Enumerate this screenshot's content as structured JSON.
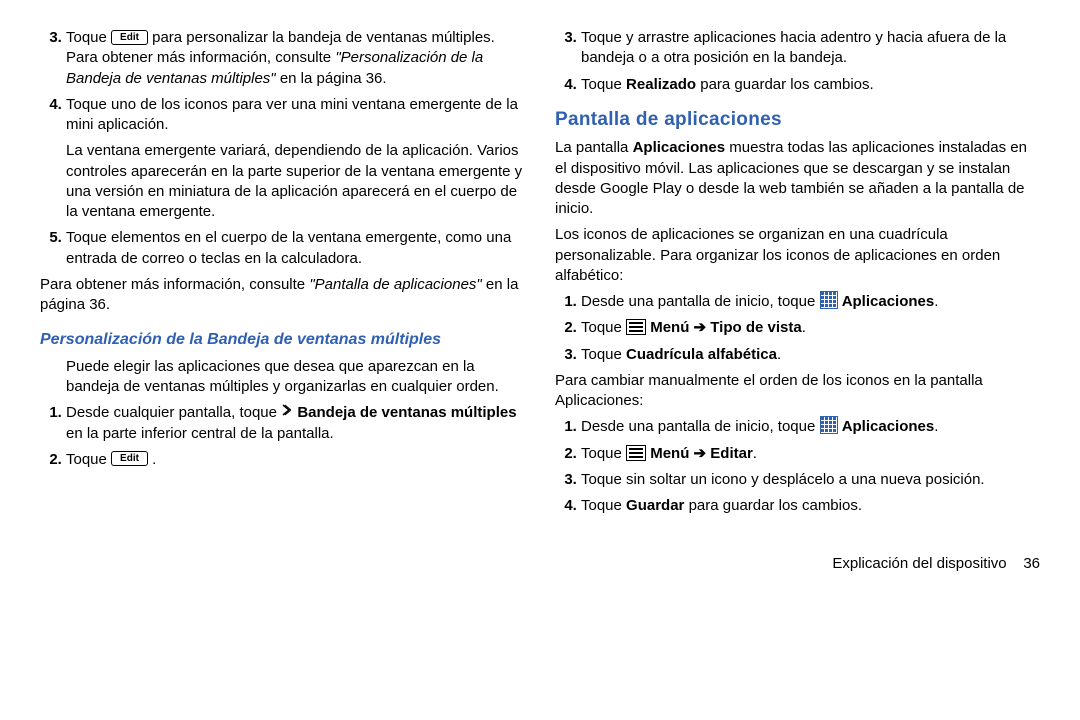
{
  "left": {
    "li3_a": "Toque ",
    "edit": "Edit",
    "li3_b": " para personalizar la bandeja de ventanas múltiples. Para obtener más información, consulte ",
    "li3_c": "\"Personalización de la Bandeja de ventanas múltiples\"",
    "li3_d": " en la página 36.",
    "li4": "Toque uno de los iconos para ver una mini ventana emergente de la mini aplicación.",
    "li4_p": "La ventana emergente variará, dependiendo de la aplicación. Varios controles aparecerán en la parte superior de la ventana emergente y una versión en miniatura de la aplicación aparecerá en el cuerpo de la ventana emergente.",
    "li5": "Toque elementos en el cuerpo de la ventana emergente, como una entrada de correo o teclas en la calculadora.",
    "more_a": "Para obtener más información, consulte ",
    "more_b": "\"Pantalla de aplicaciones\"",
    "more_c": "  en la página 36.",
    "h3": "Personalización de la Bandeja de ventanas múltiples",
    "p1": "Puede elegir las aplicaciones que desea que aparezcan en la bandeja de ventanas múltiples y organizarlas en cualquier orden.",
    "o1_a": "Desde cualquier pantalla, toque ",
    "o1_b": "Bandeja de ventanas múltiples",
    "o1_c": " en la parte inferior central de la pantalla.",
    "o2_a": "Toque ",
    "o2_b": "."
  },
  "right": {
    "li3": "Toque y arrastre aplicaciones hacia adentro y hacia afuera de la bandeja o a otra posición en la bandeja.",
    "li4_a": "Toque ",
    "li4_b": "Realizado",
    "li4_c": " para guardar los cambios.",
    "h2": "Pantalla de aplicaciones",
    "p1_a": "La pantalla ",
    "p1_b": "Aplicaciones",
    "p1_c": " muestra todas las aplicaciones instaladas en el dispositivo móvil. Las aplicaciones que se descargan y se instalan desde Google Play o desde la web también se añaden a la pantalla de inicio.",
    "p2": "Los iconos de aplicaciones se organizan en una cuadrícula personalizable. Para organizar los iconos de aplicaciones en orden alfabético:",
    "o1_a": "Desde una pantalla de inicio, toque ",
    "o1_b": "Aplicaciones",
    "o1_c": ".",
    "o2_a": "Toque ",
    "o2_b": "Menú ➔ Tipo de vista",
    "o2_c": ".",
    "o3_a": "Toque ",
    "o3_b": "Cuadrícula alfabética",
    "o3_c": ".",
    "p3": "Para cambiar manualmente el orden de los iconos en la pantalla Aplicaciones:",
    "b1_a": "Desde una pantalla de inicio, toque ",
    "b1_b": "Aplicaciones",
    "b1_c": ".",
    "b2_a": "Toque ",
    "b2_b": "Menú ➔ Editar",
    "b2_c": ".",
    "b3": "Toque sin soltar un icono y desplácelo a una nueva posición.",
    "b4_a": "Toque ",
    "b4_b": "Guardar",
    "b4_c": " para guardar los cambios."
  },
  "footer": {
    "section": "Explicación del dispositivo",
    "page": "36"
  }
}
